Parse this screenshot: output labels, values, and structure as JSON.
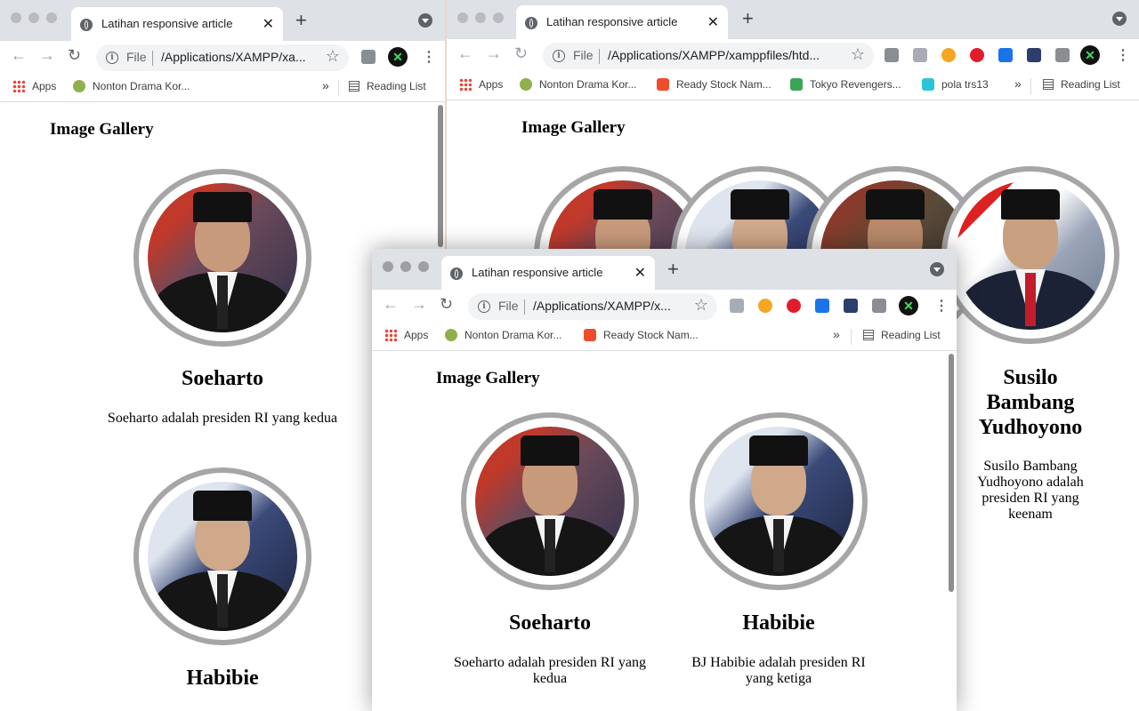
{
  "tab_title": "Latihan responsive article",
  "address": {
    "scheme": "File"
  },
  "bookmarks_bar": {
    "apps": "Apps",
    "drama": "Nonton Drama Kor...",
    "stock": "Ready Stock Nam...",
    "tokyo": "Tokyo Revengers...",
    "pola": "pola trs13",
    "more": "»",
    "reading_list": "Reading List"
  },
  "windows": {
    "left": {
      "url": "/Applications/XAMPP/xa..."
    },
    "right": {
      "url": "/Applications/XAMPP/xamppfiles/htd..."
    },
    "front": {
      "url": "/Applications/XAMPP/x..."
    }
  },
  "page": {
    "heading": "Image Gallery"
  },
  "gallery": [
    {
      "name": "Soeharto",
      "desc": "Soeharto adalah presiden RI yang kedua"
    },
    {
      "name": "Habibie",
      "desc": "BJ Habibie adalah presiden RI yang ketiga"
    },
    {
      "name": "Susilo Bambang Yudhoyono",
      "desc": "Susilo Bambang Yudhoyono adalah presiden RI yang keenam"
    }
  ],
  "partial_text": {
    "sby_name_lines": [
      "Susilo",
      "Bambang",
      "Yudhoyono"
    ],
    "sby_desc_lines": [
      "Susilo Bambang",
      "Yudhoyono adalah",
      "presiden RI yang",
      "keenam"
    ]
  },
  "colors": {
    "portrait_ring": "#a6a6a6",
    "chrome_tabstrip": "#dee1e6"
  }
}
